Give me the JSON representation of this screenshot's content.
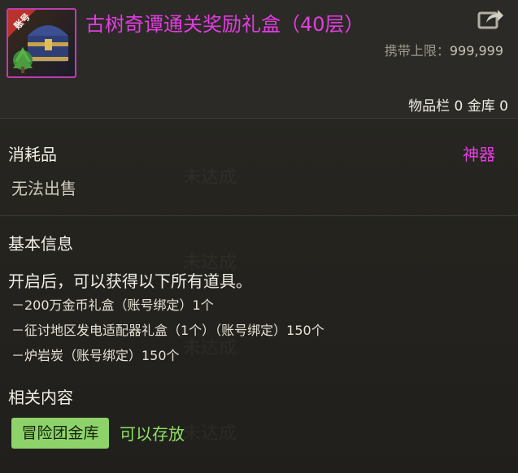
{
  "item": {
    "title": "古树奇谭通关奖励礼盒（40层）",
    "badge": "账号",
    "icon": "treasure-chest-icon",
    "title_color": "#e23de0",
    "border_color": "#b93fae"
  },
  "carry": {
    "label": "携带上限：",
    "value": "999,999"
  },
  "storage": {
    "text": "物品栏 0 金库 0"
  },
  "category": "消耗品",
  "rarity": "神器",
  "sell_status": "无法出售",
  "basic_info": {
    "title": "基本信息",
    "main": "开启后，可以获得以下所有道具。",
    "lines": [
      "－200万金币礼盒（账号绑定）1个",
      "－征讨地区发电适配器礼盒（1个）（账号绑定）150个",
      "－炉岩炭（账号绑定）150个"
    ]
  },
  "related": {
    "title": "相关内容",
    "tag": "冒险团金库",
    "note": "可以存放",
    "tag_color": "#8ed36a",
    "note_color": "#8fe068"
  },
  "share_icon": "share-arrow-icon"
}
